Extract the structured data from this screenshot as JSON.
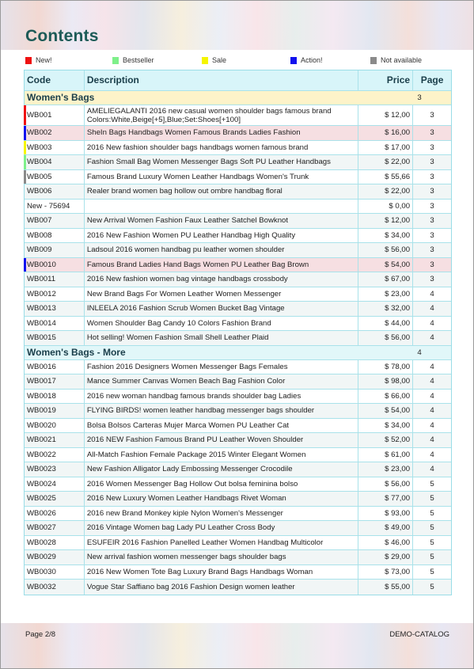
{
  "title": "Contents",
  "legend": [
    {
      "label": "New!",
      "color": "#ee1111"
    },
    {
      "label": "Bestseller",
      "color": "#7ef08a"
    },
    {
      "label": "Sale",
      "color": "#f5f500"
    },
    {
      "label": "Action!",
      "color": "#1111ee"
    },
    {
      "label": "Not available",
      "color": "#8a8a8a"
    }
  ],
  "table": {
    "headers": {
      "code": "Code",
      "description": "Description",
      "price": "Price",
      "page": "Page"
    },
    "sections": [
      {
        "name": "Women's Bags",
        "page": "3",
        "rows": [
          {
            "code": "WB001",
            "description": "AMELIEGALANTI 2016 new casual women shoulder bags famous brand Colors:White,Beige[+5],Blue;Set:Shoes[+100]",
            "price": "$ 12,00",
            "page": "3",
            "marker": "#ee1111"
          },
          {
            "code": "WB002",
            "description": "SheIn Bags Handbags Women Famous Brands Ladies Fashion",
            "price": "$ 16,00",
            "page": "3",
            "marker": "#1111ee",
            "highlight": true
          },
          {
            "code": "WB003",
            "description": "2016 New fashion shoulder bags handbags women famous brand",
            "price": "$ 17,00",
            "page": "3",
            "marker": "#f5f500"
          },
          {
            "code": "WB004",
            "description": "Fashion Small Bag Women Messenger Bags Soft PU Leather Handbags",
            "price": "$ 22,00",
            "page": "3",
            "marker": "#7ef08a"
          },
          {
            "code": "WB005",
            "description": "Famous Brand Luxury Women Leather Handbags Women's Trunk",
            "price": "$ 55,66",
            "page": "3",
            "marker": "#8a8a8a"
          },
          {
            "code": "WB006",
            "description": "Realer brand women bag hollow out ombre handbag floral",
            "price": "$ 22,00",
            "page": "3"
          },
          {
            "code": "New - 75694",
            "description": "",
            "price": "$ 0,00",
            "page": "3"
          },
          {
            "code": "WB007",
            "description": "New Arrival Women Fashion Faux Leather Satchel Bowknot",
            "price": "$ 12,00",
            "page": "3"
          },
          {
            "code": "WB008",
            "description": "2016 New Fashion Women PU Leather Handbag High Quality",
            "price": "$ 34,00",
            "page": "3"
          },
          {
            "code": "WB009",
            "description": "Ladsoul 2016 women handbag pu leather women shoulder",
            "price": "$ 56,00",
            "page": "3"
          },
          {
            "code": "WB0010",
            "description": "Famous Brand Ladies Hand Bags Women PU Leather Bag Brown",
            "price": "$ 54,00",
            "page": "3",
            "marker": "#1111ee",
            "highlight": true
          },
          {
            "code": "WB0011",
            "description": "2016 New fashion women bag vintage handbags crossbody",
            "price": "$ 67,00",
            "page": "3"
          },
          {
            "code": "WB0012",
            "description": "New Brand Bags For Women Leather Women Messenger",
            "price": "$ 23,00",
            "page": "4"
          },
          {
            "code": "WB0013",
            "description": "INLEELA 2016 Fashion Scrub Women Bucket Bag Vintage",
            "price": "$ 32,00",
            "page": "4"
          },
          {
            "code": "WB0014",
            "description": "Women Shoulder Bag Candy 10 Colors Fashion Brand",
            "price": "$ 44,00",
            "page": "4"
          },
          {
            "code": "WB0015",
            "description": "Hot selling! Women Fashion Small Shell Leather Plaid",
            "price": "$ 56,00",
            "page": "4"
          }
        ]
      },
      {
        "name": "Women's Bags - More",
        "page": "4",
        "rows": [
          {
            "code": "WB0016",
            "description": "Fashion 2016 Designers Women Messenger Bags Females",
            "price": "$ 78,00",
            "page": "4"
          },
          {
            "code": "WB0017",
            "description": "Mance Summer Canvas Women Beach Bag Fashion Color",
            "price": "$ 98,00",
            "page": "4"
          },
          {
            "code": "WB0018",
            "description": "2016 new woman handbag famous brands shoulder bag Ladies",
            "price": "$ 66,00",
            "page": "4"
          },
          {
            "code": "WB0019",
            "description": "FLYING BIRDS! women leather handbag messenger bags shoulder",
            "price": "$ 54,00",
            "page": "4"
          },
          {
            "code": "WB0020",
            "description": "Bolsa Bolsos Carteras Mujer Marca Women PU Leather Cat",
            "price": "$ 34,00",
            "page": "4"
          },
          {
            "code": "WB0021",
            "description": "2016 NEW Fashion Famous Brand PU Leather Woven Shoulder",
            "price": "$ 52,00",
            "page": "4"
          },
          {
            "code": "WB0022",
            "description": "All-Match Fashion Female Package 2015 Winter Elegant Women",
            "price": "$ 61,00",
            "page": "4"
          },
          {
            "code": "WB0023",
            "description": "New Fashion Alligator Lady Embossing Messenger Crocodile",
            "price": "$ 23,00",
            "page": "4"
          },
          {
            "code": "WB0024",
            "description": "2016 Women Messenger Bag Hollow Out bolsa feminina bolso",
            "price": "$ 56,00",
            "page": "5"
          },
          {
            "code": "WB0025",
            "description": "2016 New Luxury Women Leather Handbags Rivet Woman",
            "price": "$ 77,00",
            "page": "5"
          },
          {
            "code": "WB0026",
            "description": "2016 new Brand Monkey kiple Nylon Women's Messenger",
            "price": "$ 93,00",
            "page": "5"
          },
          {
            "code": "WB0027",
            "description": "2016 Vintage Women bag Lady PU Leather Cross Body",
            "price": "$ 49,00",
            "page": "5"
          },
          {
            "code": "WB0028",
            "description": "ESUFEIR 2016 Fashion Panelled Leather Women Handbag Multicolor",
            "price": "$ 46,00",
            "page": "5"
          },
          {
            "code": "WB0029",
            "description": "New arrival fashion women messenger bags shoulder bags",
            "price": "$ 29,00",
            "page": "5"
          },
          {
            "code": "WB0030",
            "description": "2016 New Women Tote Bag Luxury Brand Bags Handbags Woman",
            "price": "$ 73,00",
            "page": "5"
          },
          {
            "code": "WB0032",
            "description": "Vogue Star Saffiano bag 2016 Fashion Design women leather",
            "price": "$ 55,00",
            "page": "5"
          }
        ]
      }
    ]
  },
  "footer": {
    "page_label": "Page 2/8",
    "catalog_name": "DEMO-CATALOG"
  }
}
